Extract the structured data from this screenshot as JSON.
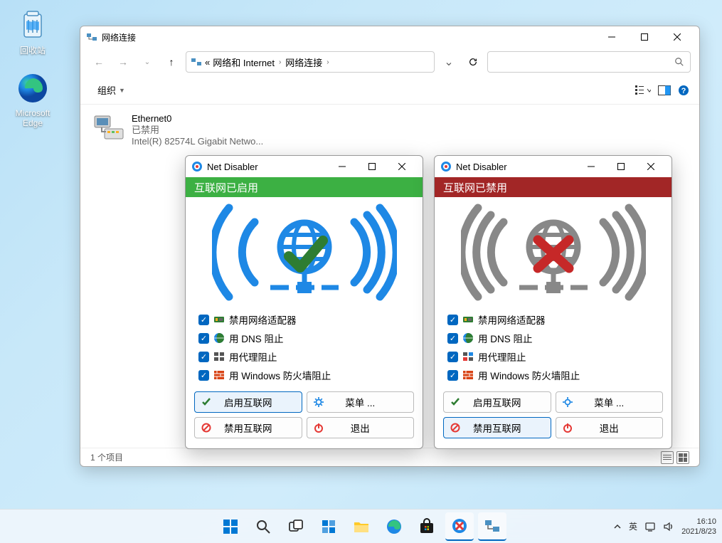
{
  "desktop": {
    "recycle": "回收站",
    "edge": "Microsoft Edge"
  },
  "explorer": {
    "title": "网络连接",
    "breadcrumb": {
      "root": "网络和 Internet",
      "current": "网络连接",
      "prefix": "«"
    },
    "toolbar": {
      "organize": "组织"
    },
    "item": {
      "name": "Ethernet0",
      "status": "已禁用",
      "adapter": "Intel(R) 82574L Gigabit Netwo..."
    },
    "statusbar": "1 个项目"
  },
  "nd": {
    "title": "Net Disabler",
    "banner_enabled": "互联网已启用",
    "banner_disabled": "互联网已禁用",
    "opts": {
      "adapter": "禁用网络适配器",
      "dns": "用 DNS 阻止",
      "proxy": "用代理阻止",
      "firewall": "用 Windows 防火墙阻止"
    },
    "btns": {
      "enable": "启用互联网",
      "menu": "菜单 ...",
      "disable": "禁用互联网",
      "exit": "退出"
    }
  },
  "tray": {
    "ime": "英",
    "time": "16:10",
    "date": "2021/8/23"
  }
}
